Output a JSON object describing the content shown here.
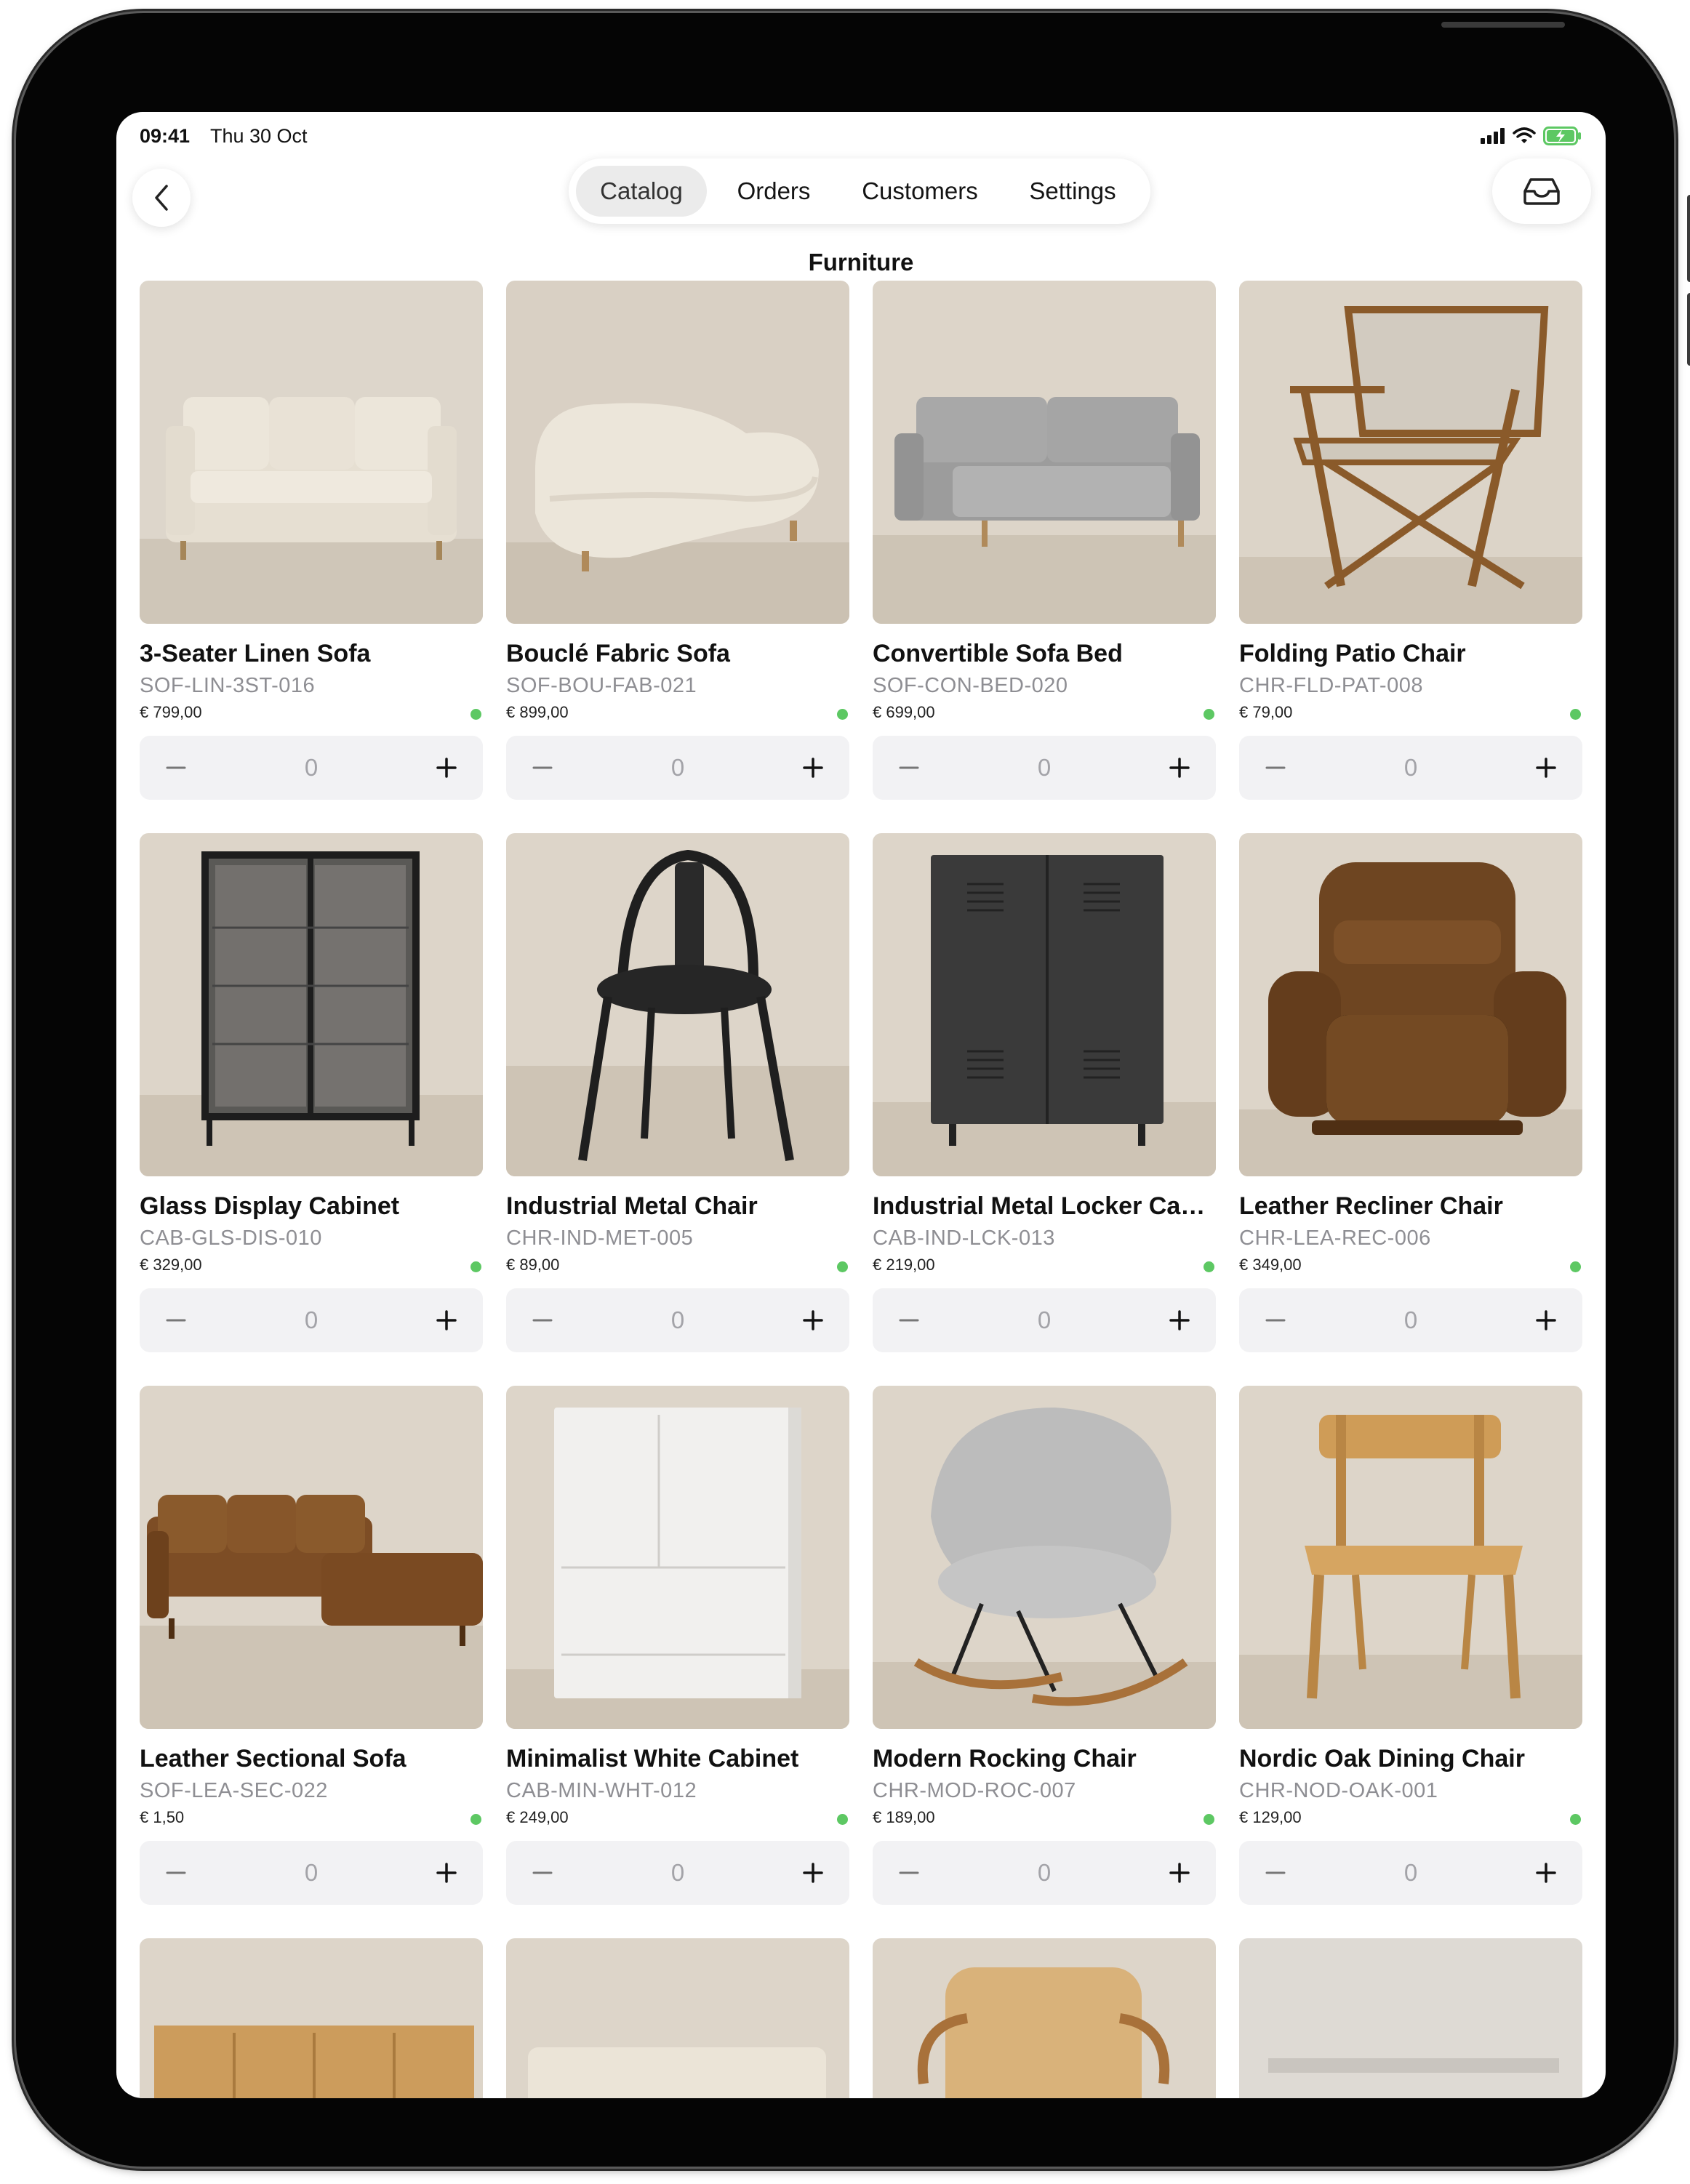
{
  "status_bar": {
    "time": "09:41",
    "date": "Thu 30 Oct"
  },
  "nav": {
    "back_icon": "chevron-left-icon",
    "tabs": [
      {
        "label": "Catalog",
        "active": true
      },
      {
        "label": "Orders",
        "active": false
      },
      {
        "label": "Customers",
        "active": false
      },
      {
        "label": "Settings",
        "active": false
      }
    ],
    "inbox_icon": "tray-icon"
  },
  "page_title": "Furniture",
  "colors": {
    "in_stock_dot": "#5dc863",
    "stepper_bg": "#f2f2f4",
    "sku_text": "#8e8e93"
  },
  "products": [
    {
      "name": "3-Seater Linen Sofa",
      "sku": "SOF-LIN-3ST-016",
      "price": "€ 799,00",
      "qty": "0",
      "image": "sofa-3-seater"
    },
    {
      "name": "Bouclé Fabric Sofa",
      "sku": "SOF-BOU-FAB-021",
      "price": "€ 899,00",
      "qty": "0",
      "image": "boucle-sofa"
    },
    {
      "name": "Convertible Sofa Bed",
      "sku": "SOF-CON-BED-020",
      "price": "€ 699,00",
      "qty": "0",
      "image": "sofa-bed"
    },
    {
      "name": "Folding Patio Chair",
      "sku": "CHR-FLD-PAT-008",
      "price": "€ 79,00",
      "qty": "0",
      "image": "folding-chair"
    },
    {
      "name": "Glass Display Cabinet",
      "sku": "CAB-GLS-DIS-010",
      "price": "€ 329,00",
      "qty": "0",
      "image": "glass-cabinet"
    },
    {
      "name": "Industrial Metal Chair",
      "sku": "CHR-IND-MET-005",
      "price": "€ 89,00",
      "qty": "0",
      "image": "metal-chair"
    },
    {
      "name": "Industrial Metal Locker Cabi...",
      "sku": "CAB-IND-LCK-013",
      "price": "€ 219,00",
      "qty": "0",
      "image": "locker-cabinet"
    },
    {
      "name": "Leather Recliner Chair",
      "sku": "CHR-LEA-REC-006",
      "price": "€ 349,00",
      "qty": "0",
      "image": "recliner"
    },
    {
      "name": "Leather Sectional Sofa",
      "sku": "SOF-LEA-SEC-022",
      "price": "€ 1,50",
      "qty": "0",
      "image": "sectional-sofa"
    },
    {
      "name": "Minimalist White Cabinet",
      "sku": "CAB-MIN-WHT-012",
      "price": "€ 249,00",
      "qty": "0",
      "image": "white-cabinet"
    },
    {
      "name": "Modern Rocking Chair",
      "sku": "CHR-MOD-ROC-007",
      "price": "€ 189,00",
      "qty": "0",
      "image": "rocking-chair"
    },
    {
      "name": "Nordic Oak Dining Chair",
      "sku": "CHR-NOD-OAK-001",
      "price": "€ 129,00",
      "qty": "0",
      "image": "oak-chair"
    }
  ],
  "partial_products": [
    {
      "image": "oak-sideboard"
    },
    {
      "image": "cream-sofa"
    },
    {
      "image": "rattan-chair"
    },
    {
      "image": "grey-item"
    }
  ]
}
